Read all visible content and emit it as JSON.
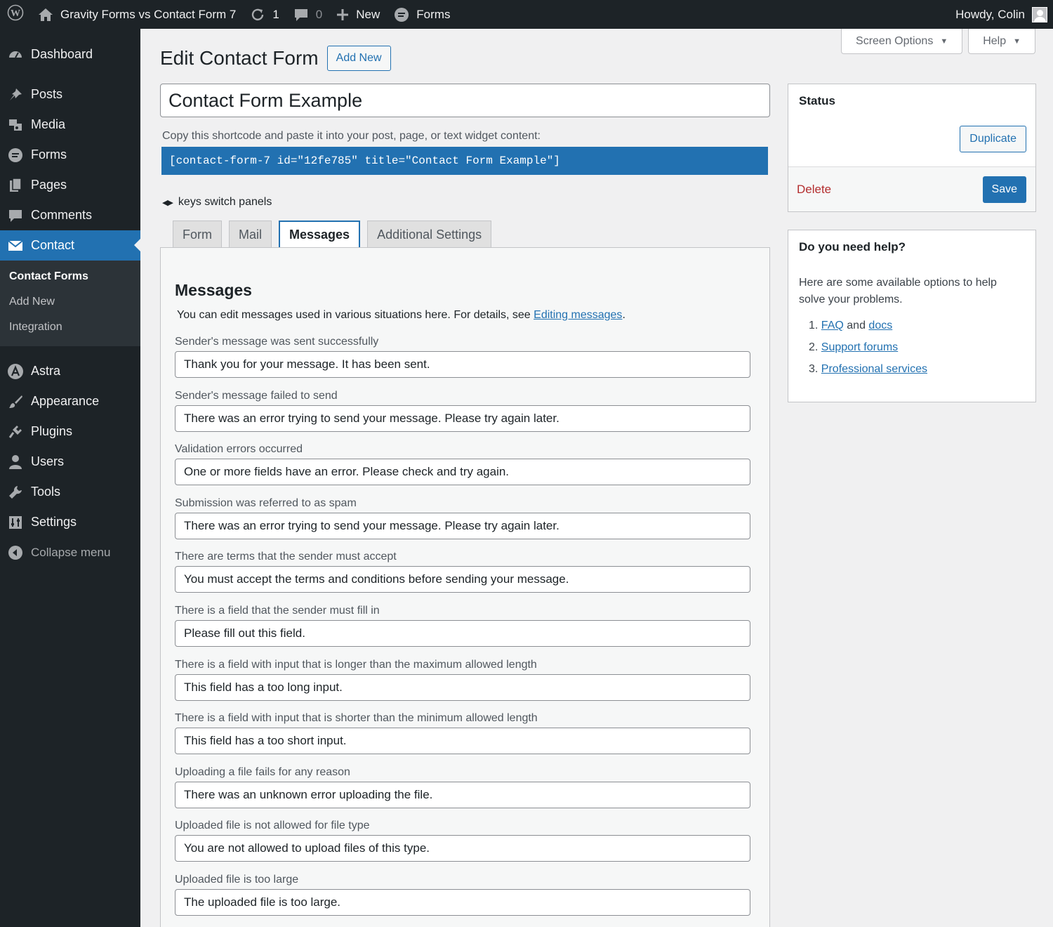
{
  "adminbar": {
    "site_name": "Gravity Forms vs Contact Form 7",
    "updates_count": "1",
    "comments_count": "0",
    "new_label": "New",
    "forms_label": "Forms",
    "greeting": "Howdy, Colin"
  },
  "sidebar": {
    "items": [
      {
        "label": "Dashboard",
        "icon": "dashboard-icon"
      },
      {
        "label": "Posts",
        "icon": "pin-icon"
      },
      {
        "label": "Media",
        "icon": "media-icon"
      },
      {
        "label": "Forms",
        "icon": "forms-icon"
      },
      {
        "label": "Pages",
        "icon": "pages-icon"
      },
      {
        "label": "Comments",
        "icon": "comment-icon"
      },
      {
        "label": "Contact",
        "icon": "envelope-icon"
      }
    ],
    "submenu": [
      "Contact Forms",
      "Add New",
      "Integration"
    ],
    "items_bottom": [
      {
        "label": "Astra",
        "icon": "astra-icon"
      },
      {
        "label": "Appearance",
        "icon": "brush-icon"
      },
      {
        "label": "Plugins",
        "icon": "plug-icon"
      },
      {
        "label": "Users",
        "icon": "user-icon"
      },
      {
        "label": "Tools",
        "icon": "wrench-icon"
      },
      {
        "label": "Settings",
        "icon": "settings-icon"
      }
    ],
    "collapse_label": "Collapse menu"
  },
  "top_tabs": {
    "screen_options": "Screen Options",
    "help": "Help"
  },
  "page": {
    "title": "Edit Contact Form",
    "add_new": "Add New",
    "form_title": "Contact Form Example",
    "shortcode_label": "Copy this shortcode and paste it into your post, page, or text widget content:",
    "shortcode": "[contact-form-7 id=\"12fe785\" title=\"Contact Form Example\"]",
    "keys_hint": "keys switch panels"
  },
  "tabs": [
    "Form",
    "Mail",
    "Messages",
    "Additional Settings"
  ],
  "panel": {
    "title": "Messages",
    "desc_prefix": "You can edit messages used in various situations here. For details, see ",
    "desc_link": "Editing messages",
    "desc_suffix": ".",
    "fields": [
      {
        "label": "Sender's message was sent successfully",
        "value": "Thank you for your message. It has been sent."
      },
      {
        "label": "Sender's message failed to send",
        "value": "There was an error trying to send your message. Please try again later."
      },
      {
        "label": "Validation errors occurred",
        "value": "One or more fields have an error. Please check and try again."
      },
      {
        "label": "Submission was referred to as spam",
        "value": "There was an error trying to send your message. Please try again later."
      },
      {
        "label": "There are terms that the sender must accept",
        "value": "You must accept the terms and conditions before sending your message."
      },
      {
        "label": "There is a field that the sender must fill in",
        "value": "Please fill out this field."
      },
      {
        "label": "There is a field with input that is longer than the maximum allowed length",
        "value": "This field has a too long input."
      },
      {
        "label": "There is a field with input that is shorter than the minimum allowed length",
        "value": "This field has a too short input."
      },
      {
        "label": "Uploading a file fails for any reason",
        "value": "There was an unknown error uploading the file."
      },
      {
        "label": "Uploaded file is not allowed for file type",
        "value": "You are not allowed to upload files of this type."
      },
      {
        "label": "Uploaded file is too large",
        "value": "The uploaded file is too large."
      }
    ]
  },
  "status": {
    "title": "Status",
    "duplicate": "Duplicate",
    "delete": "Delete",
    "save": "Save"
  },
  "help": {
    "title": "Do you need help?",
    "text": "Here are some available options to help solve your problems.",
    "item1_num": "1.",
    "item1_link1": "FAQ",
    "item1_and": "and",
    "item1_link2": "docs",
    "item2_num": "2.",
    "item2_link": "Support forums",
    "item3_num": "3.",
    "item3_link": "Professional services"
  },
  "colors": {
    "accent": "#2271b1",
    "adminbar": "#1d2327",
    "delete": "#b32d2e"
  }
}
